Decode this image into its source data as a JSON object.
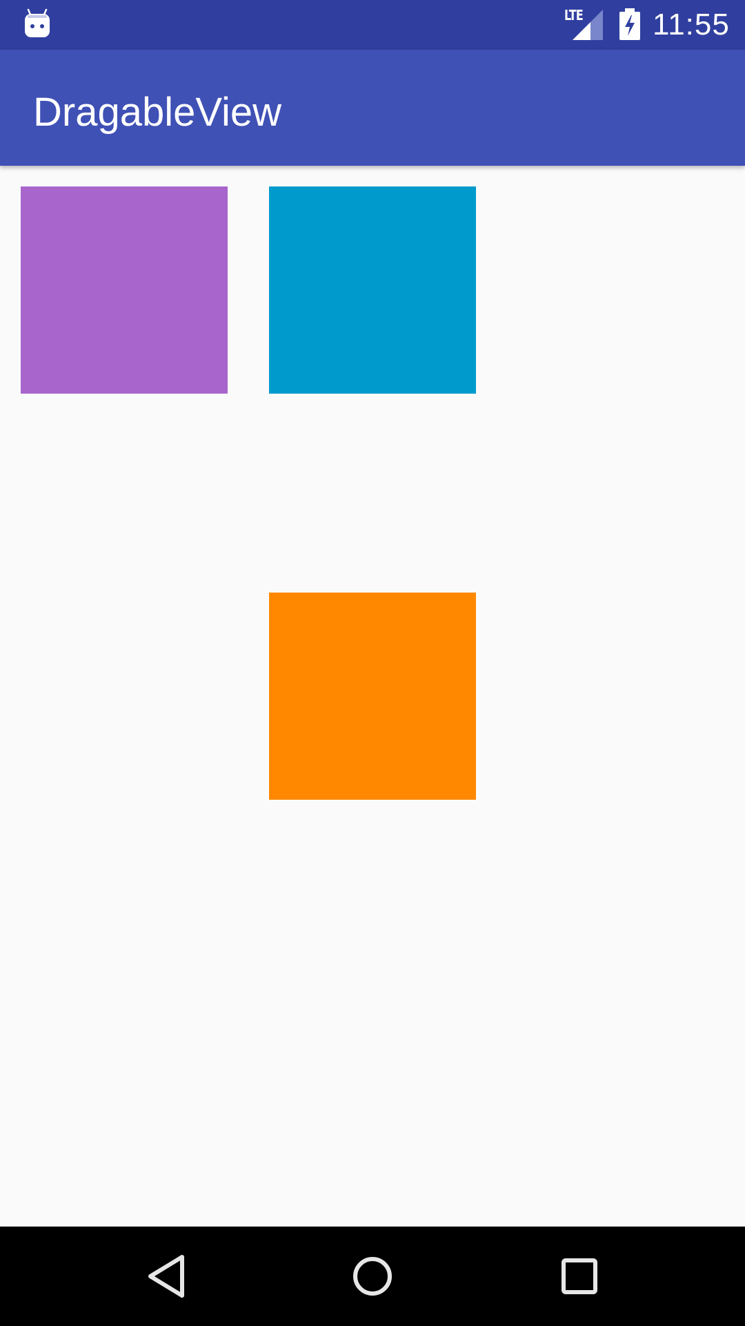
{
  "status_bar": {
    "notification_icon": "android-icon",
    "network_label": "LTE",
    "signal_icon": "signal-icon",
    "battery_icon": "battery-charging-icon",
    "time": "11:55",
    "background": "#303f9f"
  },
  "app_bar": {
    "title": "DragableView",
    "background": "#3f51b5"
  },
  "content": {
    "background": "#fafafa",
    "boxes": [
      {
        "name": "purple",
        "color": "#a866cc"
      },
      {
        "name": "blue",
        "color": "#009bcc"
      },
      {
        "name": "orange",
        "color": "#ff8800"
      }
    ]
  },
  "nav_bar": {
    "back_icon": "back-triangle-icon",
    "home_icon": "home-circle-icon",
    "recent_icon": "recent-apps-square-icon"
  }
}
